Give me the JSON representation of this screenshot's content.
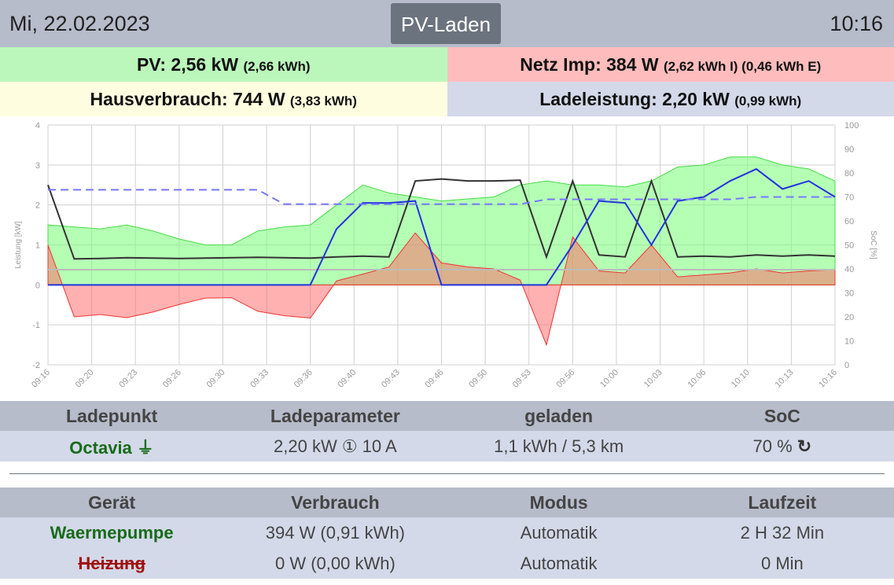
{
  "header": {
    "date": "Mi, 22.02.2023",
    "title": "PV-Laden",
    "time": "10:16"
  },
  "summary": {
    "pv": {
      "label": "PV: 2,56 kW",
      "detail": "(2,66 kWh)",
      "color": "#bbf7bb"
    },
    "grid": {
      "label": "Netz Imp: 384 W",
      "detail": "(2,62 kWh I) (0,46 kWh E)",
      "color": "#ffbcbc"
    },
    "house": {
      "label": "Hausverbrauch: 744 W",
      "detail": "(3,83 kWh)",
      "color": "#fefddf"
    },
    "charge": {
      "label": "Ladeleistung: 2,20 kW",
      "detail": "(0,99 kWh)",
      "color": "#d3d9e8"
    }
  },
  "chart_data": {
    "type": "area",
    "ylabel": "Leistung [kW]",
    "y2label": "SoC [%]",
    "ylim": [
      -2,
      4
    ],
    "yticks": [
      "-2",
      "-1",
      "0",
      "1",
      "2",
      "3",
      "4"
    ],
    "y2lim": [
      0,
      100
    ],
    "y2ticks": [
      "0",
      "10",
      "20",
      "30",
      "40",
      "50",
      "60",
      "70",
      "80",
      "90",
      "100"
    ],
    "xticks": [
      "09:16",
      "09:20",
      "09:23",
      "09:26",
      "09:30",
      "09:33",
      "09:36",
      "09:40",
      "09:43",
      "09:46",
      "09:50",
      "09:53",
      "09:56",
      "10:00",
      "10:03",
      "10:06",
      "10:10",
      "10:13",
      "10:16"
    ],
    "x_minutes": [
      0,
      2,
      4,
      6,
      8,
      10,
      12,
      14,
      16,
      18,
      20,
      22,
      24,
      26,
      28,
      30,
      32,
      34,
      36,
      38,
      40,
      42,
      44,
      46,
      48,
      50,
      52,
      54,
      56,
      58,
      60
    ],
    "series": [
      {
        "name": "PV",
        "color": "#44dd44",
        "values": [
          1.5,
          1.45,
          1.4,
          1.5,
          1.35,
          1.15,
          1.0,
          1.0,
          1.35,
          1.45,
          1.5,
          2.0,
          2.5,
          2.3,
          2.2,
          2.1,
          2.15,
          2.2,
          2.5,
          2.6,
          2.5,
          2.5,
          2.45,
          2.6,
          2.95,
          3.0,
          3.2,
          3.2,
          3.0,
          2.9,
          2.6
        ]
      },
      {
        "name": "Netz",
        "color": "#ee3333",
        "values": [
          1.0,
          -0.8,
          -0.74,
          -0.82,
          -0.68,
          -0.49,
          -0.33,
          -0.32,
          -0.66,
          -0.77,
          -0.83,
          0.1,
          0.27,
          0.45,
          1.3,
          0.55,
          0.45,
          0.4,
          0.12,
          -1.5,
          1.2,
          0.35,
          0.3,
          1.0,
          0.2,
          0.25,
          0.3,
          0.4,
          0.3,
          0.35,
          0.38
        ]
      },
      {
        "name": "Hausverbrauch",
        "color": "#333333",
        "values": [
          2.5,
          0.65,
          0.66,
          0.68,
          0.67,
          0.66,
          0.67,
          0.68,
          0.69,
          0.68,
          0.67,
          0.7,
          0.72,
          0.7,
          2.6,
          2.65,
          2.6,
          2.6,
          2.62,
          0.7,
          2.6,
          0.75,
          0.7,
          2.6,
          0.7,
          0.72,
          0.7,
          0.75,
          0.72,
          0.75,
          0.72
        ]
      },
      {
        "name": "Ladeleistung",
        "color": "#2233dd",
        "values": [
          0,
          0,
          0,
          0,
          0,
          0,
          0,
          0,
          0,
          0,
          0,
          1.4,
          2.05,
          2.05,
          2.1,
          0,
          0,
          0,
          0,
          0,
          1.0,
          2.1,
          2.05,
          1.0,
          2.1,
          2.2,
          2.6,
          2.9,
          2.4,
          2.6,
          2.2
        ]
      },
      {
        "name": "SoC",
        "color": "#7777ff",
        "axis": "right",
        "values": [
          73,
          73,
          73,
          73,
          73,
          73,
          73,
          73,
          73,
          67,
          67,
          67,
          67,
          67,
          67,
          67,
          67,
          67,
          67,
          69,
          69,
          69,
          69,
          69,
          69,
          69,
          69,
          70,
          70,
          70,
          70
        ]
      }
    ],
    "reference_line": 0.38
  },
  "charging": {
    "headers": [
      "Ladepunkt",
      "Ladeparameter",
      "geladen",
      "SoC"
    ],
    "row": {
      "name": "Octavia",
      "params": "2,20 kW ① 10 A",
      "charged": "1,1 kWh / 5,3 km",
      "soc": "70 %"
    }
  },
  "devices": {
    "headers": [
      "Gerät",
      "Verbrauch",
      "Modus",
      "Laufzeit"
    ],
    "rows": [
      {
        "name": "Waermepumpe",
        "usage": "394 W (0,91 kWh)",
        "mode": "Automatik",
        "runtime": "2 H 32 Min"
      },
      {
        "name": "Heizung",
        "usage": "0 W (0,00 kWh)",
        "mode": "Automatik",
        "runtime": "0 Min"
      }
    ]
  }
}
